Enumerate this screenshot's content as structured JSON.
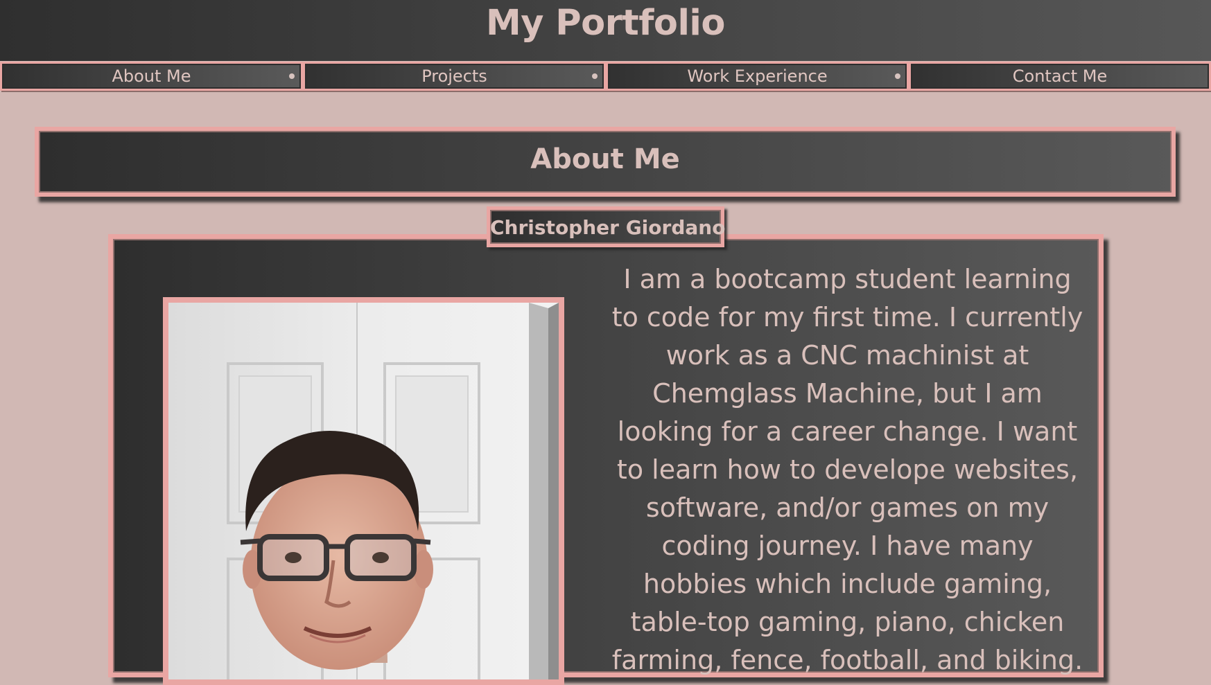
{
  "header": {
    "title": "My Portfolio"
  },
  "nav": {
    "items": [
      {
        "label": "About Me"
      },
      {
        "label": "Projects"
      },
      {
        "label": "Work Experience"
      },
      {
        "label": "Contact Me"
      }
    ]
  },
  "about": {
    "heading": "About Me",
    "name": "Christopher Giordano",
    "photo_icon": "profile-photo",
    "bio": "I am a bootcamp student learning to code for my first time. I currently work as a CNC machinist at Chemglass Machine, but I am looking for a career change. I want to learn how to develope websites, software, and/or games on my coding journey. I have many hobbies which include gaming, table-top gaming, piano, chicken farming, fence, football, and biking."
  },
  "colors": {
    "page_background": "#d1b8b4",
    "accent_border": "#e9a6a3",
    "panel_dark": "#2e2e2e",
    "panel_light": "#595959",
    "text": "#d9c0bb"
  }
}
